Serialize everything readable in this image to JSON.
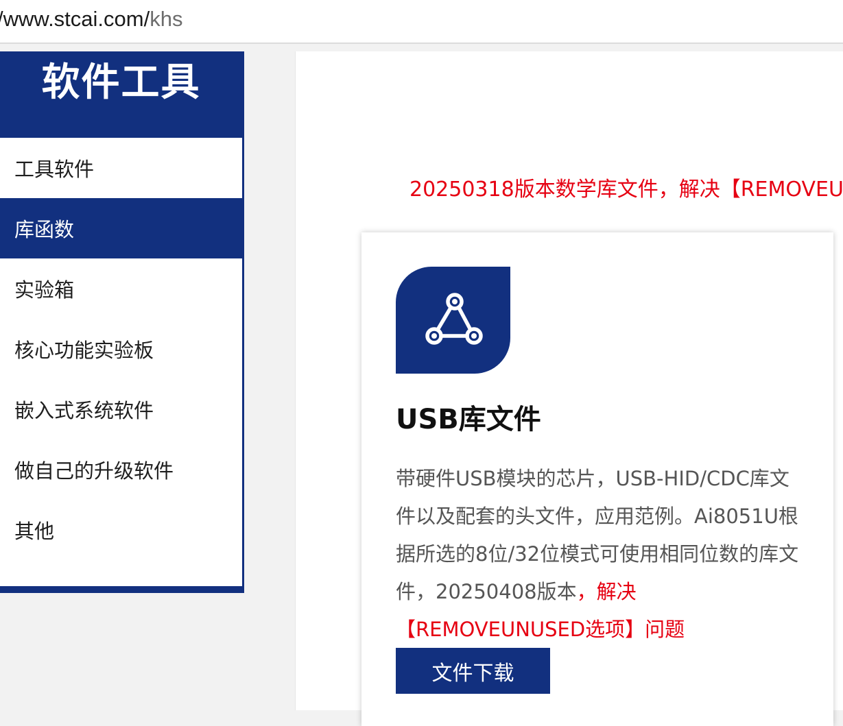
{
  "browser": {
    "url_host": "/www.stcai.com/",
    "url_path": "khs"
  },
  "sidebar": {
    "title": "软件工具",
    "items": [
      {
        "label": "工具软件"
      },
      {
        "label": "库函数"
      },
      {
        "label": "实验箱"
      },
      {
        "label": "核心功能实验板"
      },
      {
        "label": "嵌入式系统软件"
      },
      {
        "label": "做自己的升级软件"
      },
      {
        "label": "其他"
      }
    ],
    "active_index": 1
  },
  "main": {
    "banner": "20250318版本数学库文件，解决【REMOVEU",
    "card": {
      "icon": "share-network-icon",
      "title": "USB库文件",
      "description": "带硬件USB模块的芯片，USB-HID/CDC库文件以及配套的头文件，应用范例。Ai8051U根据所选的8位/32位模式可使用相同位数的库文件，20250408版本",
      "description_highlight": "，解决【REMOVEUNUSED选项】问题",
      "button_label": "文件下载"
    }
  },
  "colors": {
    "brand": "#12307f",
    "highlight": "#e60012"
  }
}
